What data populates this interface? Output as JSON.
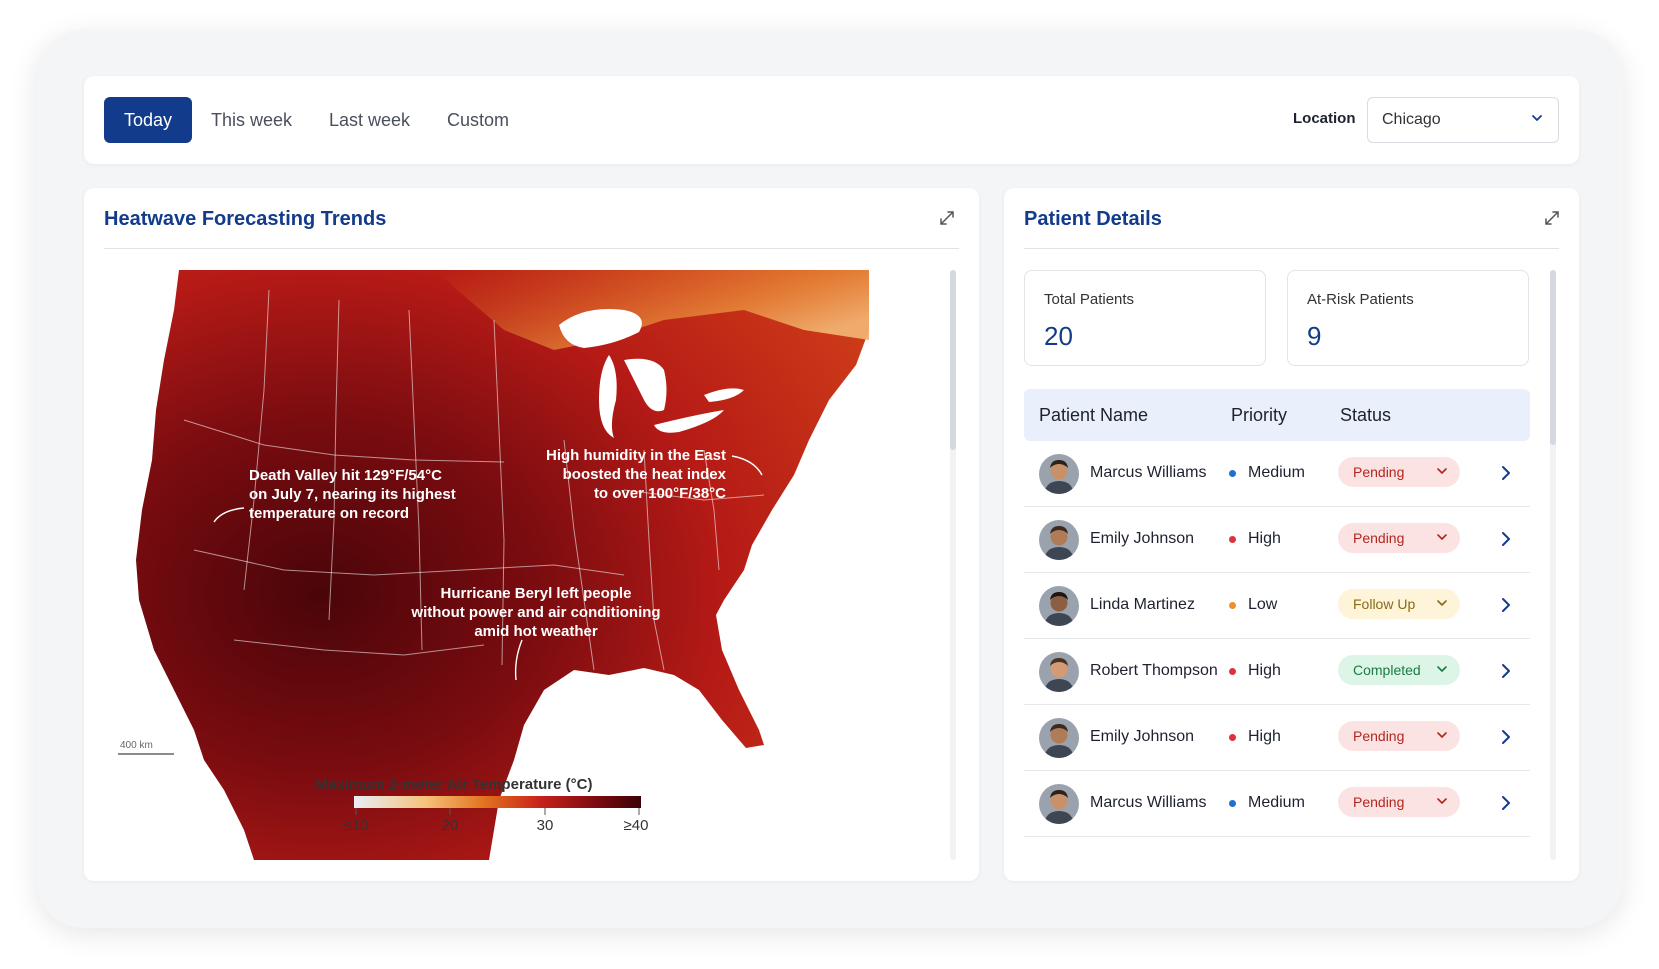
{
  "filters": {
    "tabs": [
      {
        "label": "Today",
        "active": true
      },
      {
        "label": "This week",
        "active": false
      },
      {
        "label": "Last week",
        "active": false
      },
      {
        "label": "Custom",
        "active": false
      }
    ],
    "location_label": "Location",
    "location_value": "Chicago"
  },
  "heatwave_panel": {
    "title": "Heatwave Forecasting Trends",
    "map": {
      "annotations": [
        {
          "lines": [
            "Death Valley hit 129°F/54°C",
            "on July 7, nearing its highest",
            "temperature on record"
          ]
        },
        {
          "lines": [
            "High humidity in the East",
            "boosted the heat index",
            "to over 100°F/38°C"
          ]
        },
        {
          "lines": [
            "Hurricane Beryl left people",
            "without power and air conditioning",
            "amid hot weather"
          ]
        }
      ],
      "scale_label": "400 km",
      "legend_title": "Maximum 2-meter Air Temperature (°C)",
      "legend_ticks": [
        "≤10",
        "20",
        "30",
        "≥40"
      ],
      "legend_colors": [
        "#e8eef7",
        "#f5c27a",
        "#e3741f",
        "#c7221a",
        "#7a0a0f",
        "#3b0307"
      ]
    }
  },
  "patient_panel": {
    "title": "Patient Details",
    "kpis": [
      {
        "label": "Total Patients",
        "value": "20"
      },
      {
        "label": "At-Risk Patients",
        "value": "9"
      }
    ],
    "columns": [
      "Patient Name",
      "Priority",
      "Status"
    ],
    "rows": [
      {
        "name": "Marcus Williams",
        "priority": "Medium",
        "priority_color": "#1f6fd1",
        "status": "Pending",
        "status_bg": "#fbe3e3",
        "status_color": "#b3261e"
      },
      {
        "name": "Emily Johnson",
        "priority": "High",
        "priority_color": "#e0313a",
        "status": "Pending",
        "status_bg": "#fbe3e3",
        "status_color": "#b3261e"
      },
      {
        "name": "Linda Martinez",
        "priority": "Low",
        "priority_color": "#f0902a",
        "status": "Follow Up",
        "status_bg": "#fdf4d9",
        "status_color": "#8a6a10"
      },
      {
        "name": "Robert Thompson",
        "priority": "High",
        "priority_color": "#e0313a",
        "status": "Completed",
        "status_bg": "#dcf5e6",
        "status_color": "#1c7a43"
      },
      {
        "name": "Emily Johnson",
        "priority": "High",
        "priority_color": "#e0313a",
        "status": "Pending",
        "status_bg": "#fbe3e3",
        "status_color": "#b3261e"
      },
      {
        "name": "Marcus Williams",
        "priority": "Medium",
        "priority_color": "#1f6fd1",
        "status": "Pending",
        "status_bg": "#fbe3e3",
        "status_color": "#b3261e"
      }
    ]
  },
  "icons": {
    "expand": "expand-icon",
    "chevron_down": "chevron-down-icon",
    "chevron_right": "chevron-right-icon",
    "avatar": "avatar"
  },
  "colors": {
    "brand": "#123b8c",
    "header_bg": "#e9effb"
  }
}
